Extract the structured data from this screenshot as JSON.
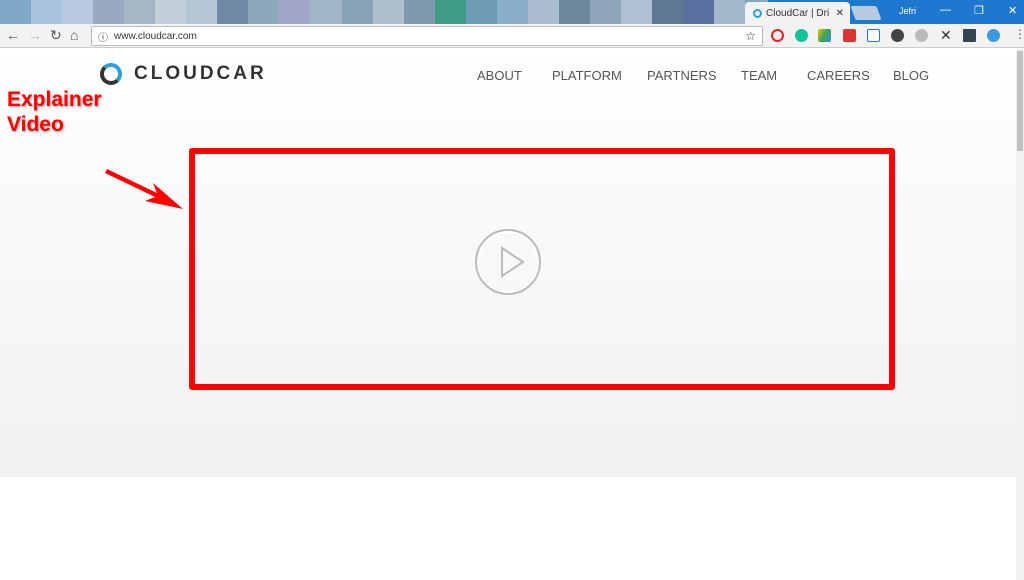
{
  "browser": {
    "tab_title": "CloudCar | Dri",
    "url": "www.cloudcar.com",
    "user": "Jefri"
  },
  "site": {
    "logo": "CLOUDCAR",
    "nav": [
      "ABOUT",
      "PLATFORM",
      "PARTNERS",
      "TEAM",
      "CAREERS",
      "BLOG"
    ]
  },
  "annotation": {
    "line1": "Explainer",
    "line2": "Video",
    "color": "#ff0000"
  },
  "video": {
    "icon": "play-icon"
  }
}
